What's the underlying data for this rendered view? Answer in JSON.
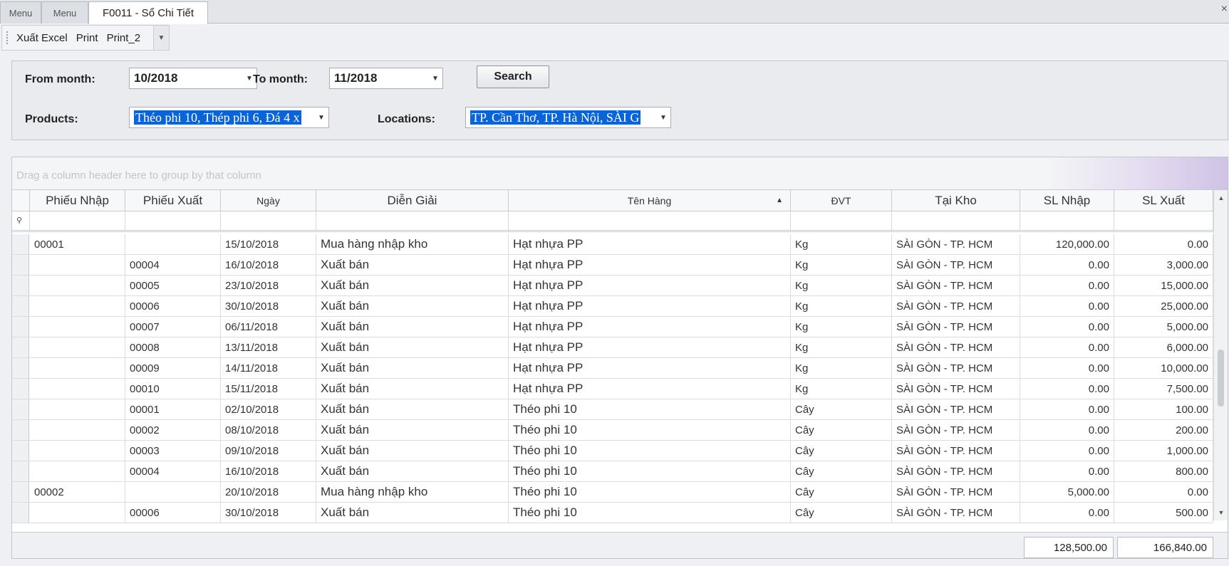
{
  "tabs": [
    {
      "label": "Menu",
      "active": false
    },
    {
      "label": "Menu",
      "active": false
    },
    {
      "label": "F0011 - Sổ Chi Tiết",
      "active": true
    }
  ],
  "toolbar": {
    "export_label": "Xuất Excel",
    "print_label": "Print",
    "print2_label": "Print_2"
  },
  "filters": {
    "from_label": "From month:",
    "from_value": "10/2018",
    "to_label": "To month:",
    "to_value": "11/2018",
    "search_label": "Search",
    "products_label": "Products:",
    "products_value": "Théo phi 10, Thép phi 6, Đá 4 x",
    "locations_label": "Locations:",
    "locations_value": "TP. Cần Thơ, TP. Hà Nội, SÀI G"
  },
  "grid": {
    "group_hint": "Drag a column header here to group by that column",
    "columns": [
      "Phiếu Nhập",
      "Phiếu Xuất",
      "Ngày",
      "Diễn Giải",
      "Tên Hàng",
      "ĐVT",
      "Tại Kho",
      "SL Nhập",
      "SL Xuất"
    ],
    "rows": [
      [
        "00001",
        "",
        "15/10/2018",
        "Mua hàng nhập kho",
        "Hạt nhựa PP",
        "Kg",
        "SÀI GÒN - TP. HCM",
        "120,000.00",
        "0.00"
      ],
      [
        "",
        "00004",
        "16/10/2018",
        "Xuất bán",
        "Hạt nhựa PP",
        "Kg",
        "SÀI GÒN - TP. HCM",
        "0.00",
        "3,000.00"
      ],
      [
        "",
        "00005",
        "23/10/2018",
        "Xuất bán",
        "Hạt nhựa PP",
        "Kg",
        "SÀI GÒN - TP. HCM",
        "0.00",
        "15,000.00"
      ],
      [
        "",
        "00006",
        "30/10/2018",
        "Xuất bán",
        "Hạt nhựa PP",
        "Kg",
        "SÀI GÒN - TP. HCM",
        "0.00",
        "25,000.00"
      ],
      [
        "",
        "00007",
        "06/11/2018",
        "Xuất bán",
        "Hạt nhựa PP",
        "Kg",
        "SÀI GÒN - TP. HCM",
        "0.00",
        "5,000.00"
      ],
      [
        "",
        "00008",
        "13/11/2018",
        "Xuất bán",
        "Hạt nhựa PP",
        "Kg",
        "SÀI GÒN - TP. HCM",
        "0.00",
        "6,000.00"
      ],
      [
        "",
        "00009",
        "14/11/2018",
        "Xuất bán",
        "Hạt nhựa PP",
        "Kg",
        "SÀI GÒN - TP. HCM",
        "0.00",
        "10,000.00"
      ],
      [
        "",
        "00010",
        "15/11/2018",
        "Xuất bán",
        "Hạt nhựa PP",
        "Kg",
        "SÀI GÒN - TP. HCM",
        "0.00",
        "7,500.00"
      ],
      [
        "",
        "00001",
        "02/10/2018",
        "Xuất bán",
        "Théo phi 10",
        "Cây",
        "SÀI GÒN - TP. HCM",
        "0.00",
        "100.00"
      ],
      [
        "",
        "00002",
        "08/10/2018",
        "Xuất bán",
        "Théo phi 10",
        "Cây",
        "SÀI GÒN - TP. HCM",
        "0.00",
        "200.00"
      ],
      [
        "",
        "00003",
        "09/10/2018",
        "Xuất bán",
        "Théo phi 10",
        "Cây",
        "SÀI GÒN - TP. HCM",
        "0.00",
        "1,000.00"
      ],
      [
        "",
        "00004",
        "16/10/2018",
        "Xuất bán",
        "Théo phi 10",
        "Cây",
        "SÀI GÒN - TP. HCM",
        "0.00",
        "800.00"
      ],
      [
        "00002",
        "",
        "20/10/2018",
        "Mua hàng nhập kho",
        "Théo phi 10",
        "Cây",
        "SÀI GÒN - TP. HCM",
        "5,000.00",
        "0.00"
      ],
      [
        "",
        "00006",
        "30/10/2018",
        "Xuất bán",
        "Théo phi 10",
        "Cây",
        "SÀI GÒN - TP. HCM",
        "0.00",
        "500.00"
      ]
    ],
    "totals": {
      "sl_nhap": "128,500.00",
      "sl_xuat": "166,840.00"
    }
  }
}
